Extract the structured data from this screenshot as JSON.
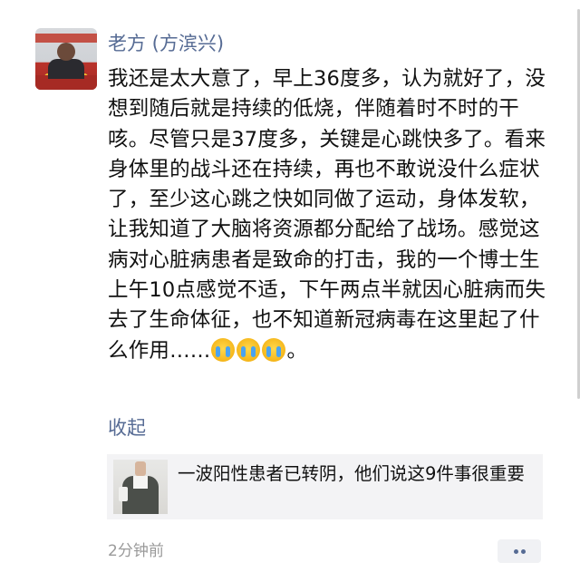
{
  "post": {
    "username": "老方 (方滨兴)",
    "text": "我还是太大意了，早上36度多，认为就好了，没想到随后就是持续的低烧，伴随着时不时的干咳。尽管只是37度多，关键是心跳快多了。看来身体里的战斗还在持续，再也不敢说没什么症状了，至少这心跳之快如同做了运动，身体发软，让我知道了大脑将资源都分配给了战场。感觉这病对心脏病患者是致命的打击，我的一个博士生上午10点感觉不适，下午两点半就因心脏病而失去了生命体征，也不知道新冠病毒在这里起了什么作用……",
    "text_end": "。",
    "emojis": [
      "crying-face-icon",
      "crying-face-icon",
      "crying-face-icon"
    ],
    "collapse_label": "收起",
    "shared_article": {
      "title": "一波阳性患者已转阴，他们说这9件事很重要"
    },
    "timestamp": "2分钟前",
    "more_icon": "more-dots-icon"
  },
  "colors": {
    "link": "#566b94",
    "text": "#111111",
    "meta": "#9a9a9a",
    "card_bg": "#f3f3f5"
  }
}
